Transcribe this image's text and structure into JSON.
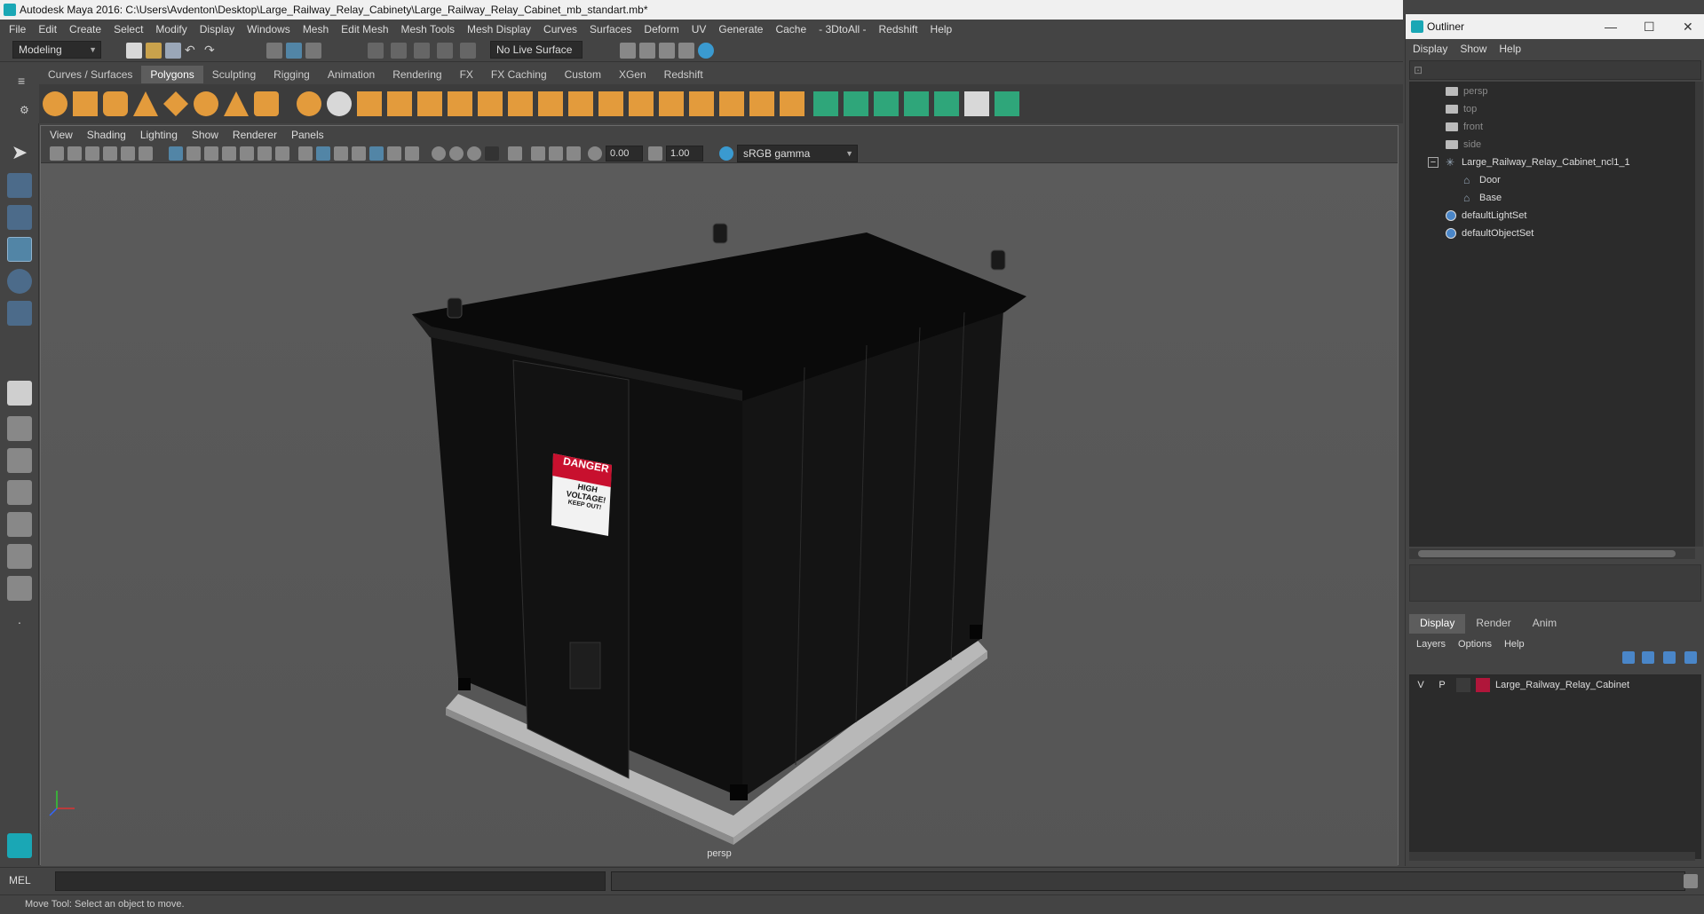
{
  "window": {
    "title": "Autodesk Maya 2016: C:\\Users\\Avdenton\\Desktop\\Large_Railway_Relay_Cabinety\\Large_Railway_Relay_Cabinet_mb_standart.mb*"
  },
  "menubar": {
    "items": [
      "File",
      "Edit",
      "Create",
      "Select",
      "Modify",
      "Display",
      "Windows",
      "Mesh",
      "Edit Mesh",
      "Mesh Tools",
      "Mesh Display",
      "Curves",
      "Surfaces",
      "Deform",
      "UV",
      "Generate",
      "Cache",
      "- 3DtoAll -",
      "Redshift",
      "Help"
    ]
  },
  "statusline": {
    "mode": "Modeling",
    "live_surface": "No Live Surface"
  },
  "shelf": {
    "tabs": [
      "Curves / Surfaces",
      "Polygons",
      "Sculpting",
      "Rigging",
      "Animation",
      "Rendering",
      "FX",
      "FX Caching",
      "Custom",
      "XGen",
      "Redshift"
    ],
    "active_tab": "Polygons"
  },
  "viewport": {
    "menu": [
      "View",
      "Shading",
      "Lighting",
      "Show",
      "Renderer",
      "Panels"
    ],
    "exposure": "0.00",
    "gamma": "1.00",
    "color_space": "sRGB gamma",
    "camera": "persp",
    "sign": {
      "line1": "DANGER",
      "line2": "HIGH",
      "line3": "VOLTAGE!",
      "line4": "KEEP OUT!"
    }
  },
  "outliner": {
    "title": "Outliner",
    "menu": [
      "Display",
      "Show",
      "Help"
    ],
    "items": [
      {
        "label": "persp",
        "type": "camera"
      },
      {
        "label": "top",
        "type": "camera"
      },
      {
        "label": "front",
        "type": "camera"
      },
      {
        "label": "side",
        "type": "camera"
      },
      {
        "label": "Large_Railway_Relay_Cabinet_ncl1_1",
        "type": "group"
      },
      {
        "label": "Door",
        "type": "mesh"
      },
      {
        "label": "Base",
        "type": "mesh"
      },
      {
        "label": "defaultLightSet",
        "type": "set"
      },
      {
        "label": "defaultObjectSet",
        "type": "set"
      }
    ]
  },
  "layers": {
    "tabs": [
      "Display",
      "Render",
      "Anim"
    ],
    "active_tab": "Display",
    "menu": [
      "Layers",
      "Options",
      "Help"
    ],
    "rows": [
      {
        "visible": "V",
        "playback": "P",
        "color": "#b0163a",
        "name": "Large_Railway_Relay_Cabinet"
      }
    ]
  },
  "commandline": {
    "language": "MEL"
  },
  "helpline": {
    "text": "Move Tool: Select an object to move."
  },
  "colors": {
    "accent": "#5285a6",
    "maya_teal": "#1aa7b5",
    "shelf_orange": "#e39b3c",
    "shelf_green": "#2fa67a"
  }
}
